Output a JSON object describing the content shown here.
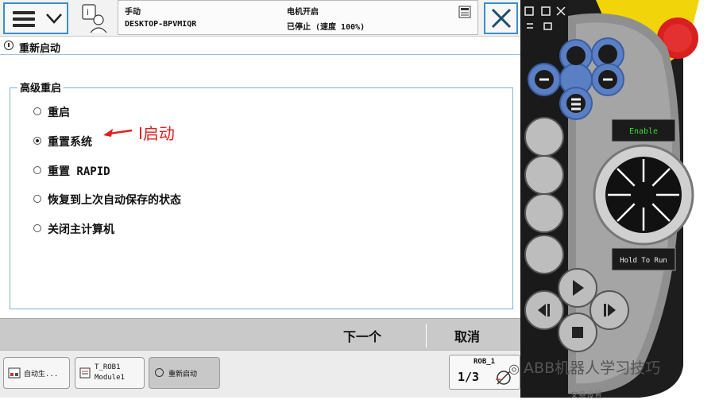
{
  "topbar": {
    "mode_label": "手动",
    "host_name": "DESKTOP-BPVMIQR",
    "motor_label": "电机开启",
    "state_label": "已停止 (速度 100%)"
  },
  "titlebar": {
    "title": "重新启动"
  },
  "group": {
    "title": "高级重启",
    "options": [
      {
        "label": "重启",
        "selected": false
      },
      {
        "label": "重置系统",
        "selected": true
      },
      {
        "label": "重置 RAPID",
        "selected": false
      },
      {
        "label": "恢复到上次自动保存的状态",
        "selected": false
      },
      {
        "label": "关闭主计算机",
        "selected": false
      }
    ]
  },
  "annotation": {
    "text": "I启动",
    "color": "#e02020"
  },
  "actions": {
    "next_label": "下一个",
    "cancel_label": "取消"
  },
  "taskbar": {
    "task1_label": "自动生...",
    "task2_line1": "T_ROB1",
    "task2_line2": "Module1",
    "task3_label": "重新启动",
    "rob_label": "ROB_1",
    "fraction_label": "1/3"
  },
  "pendant": {
    "enable_label": "Enable",
    "hold_label": "Hold To Run"
  },
  "watermark": {
    "text": "ABB机器人学习技巧",
    "subtext": "文章设置"
  },
  "colors": {
    "accent": "#3a8fc8",
    "annotation": "#e02020",
    "joystick_blue": "#5b7fc4",
    "stop_red": "#d82020",
    "yellow": "#f2d40a"
  }
}
